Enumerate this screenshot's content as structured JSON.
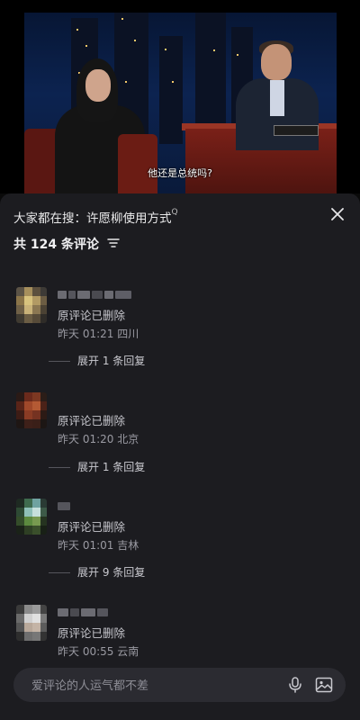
{
  "video": {
    "subtitle": "他还是总统吗?",
    "nameplate_text": ""
  },
  "panel": {
    "search_prefix": "大家都在搜：",
    "search_term": "许愿柳使用方式",
    "search_superscript": "Q",
    "comment_count": "共 124 条评论",
    "close_icon": "close-icon"
  },
  "comments": [
    {
      "text": "原评论已删除",
      "meta": "昨天 01:21 四川",
      "expand": "展开 1 条回复"
    },
    {
      "text": "原评论已删除",
      "meta": "昨天 01:20 北京",
      "expand": "展开 1 条回复"
    },
    {
      "text": "原评论已删除",
      "meta": "昨天 01:01 吉林",
      "expand": "展开 9 条回复"
    },
    {
      "text": "原评论已删除",
      "meta": "昨天 00:55 云南",
      "expand": ""
    }
  ],
  "input": {
    "placeholder": "爱评论的人运气都不差",
    "mic_icon": "microphone-icon",
    "image_icon": "image-icon"
  },
  "colors": {
    "panel_bg": "#1c1c20",
    "input_bg": "#2b2b31",
    "text_primary": "#e9e9ea",
    "text_secondary": "#9a9aa2"
  }
}
